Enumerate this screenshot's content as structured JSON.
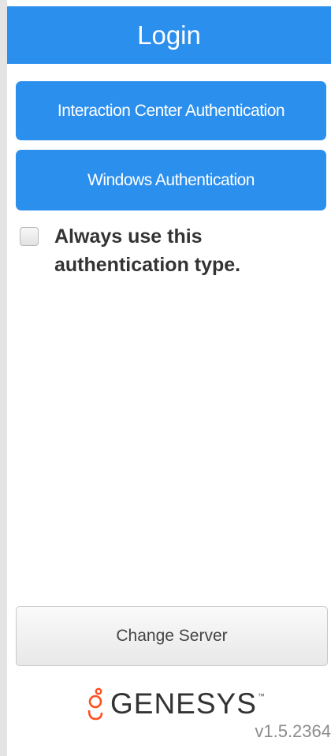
{
  "header": {
    "title": "Login"
  },
  "auth": {
    "interaction_center_label": "Interaction Center Authentication",
    "windows_label": "Windows Authentication"
  },
  "remember": {
    "label": "Always use this authentication type.",
    "checked": false
  },
  "footer": {
    "change_server_label": "Change Server",
    "brand": "GENESYS",
    "version": "v1.5.2364"
  },
  "colors": {
    "primary": "#2b8fee",
    "brand_orange": "#ff4f1f"
  }
}
